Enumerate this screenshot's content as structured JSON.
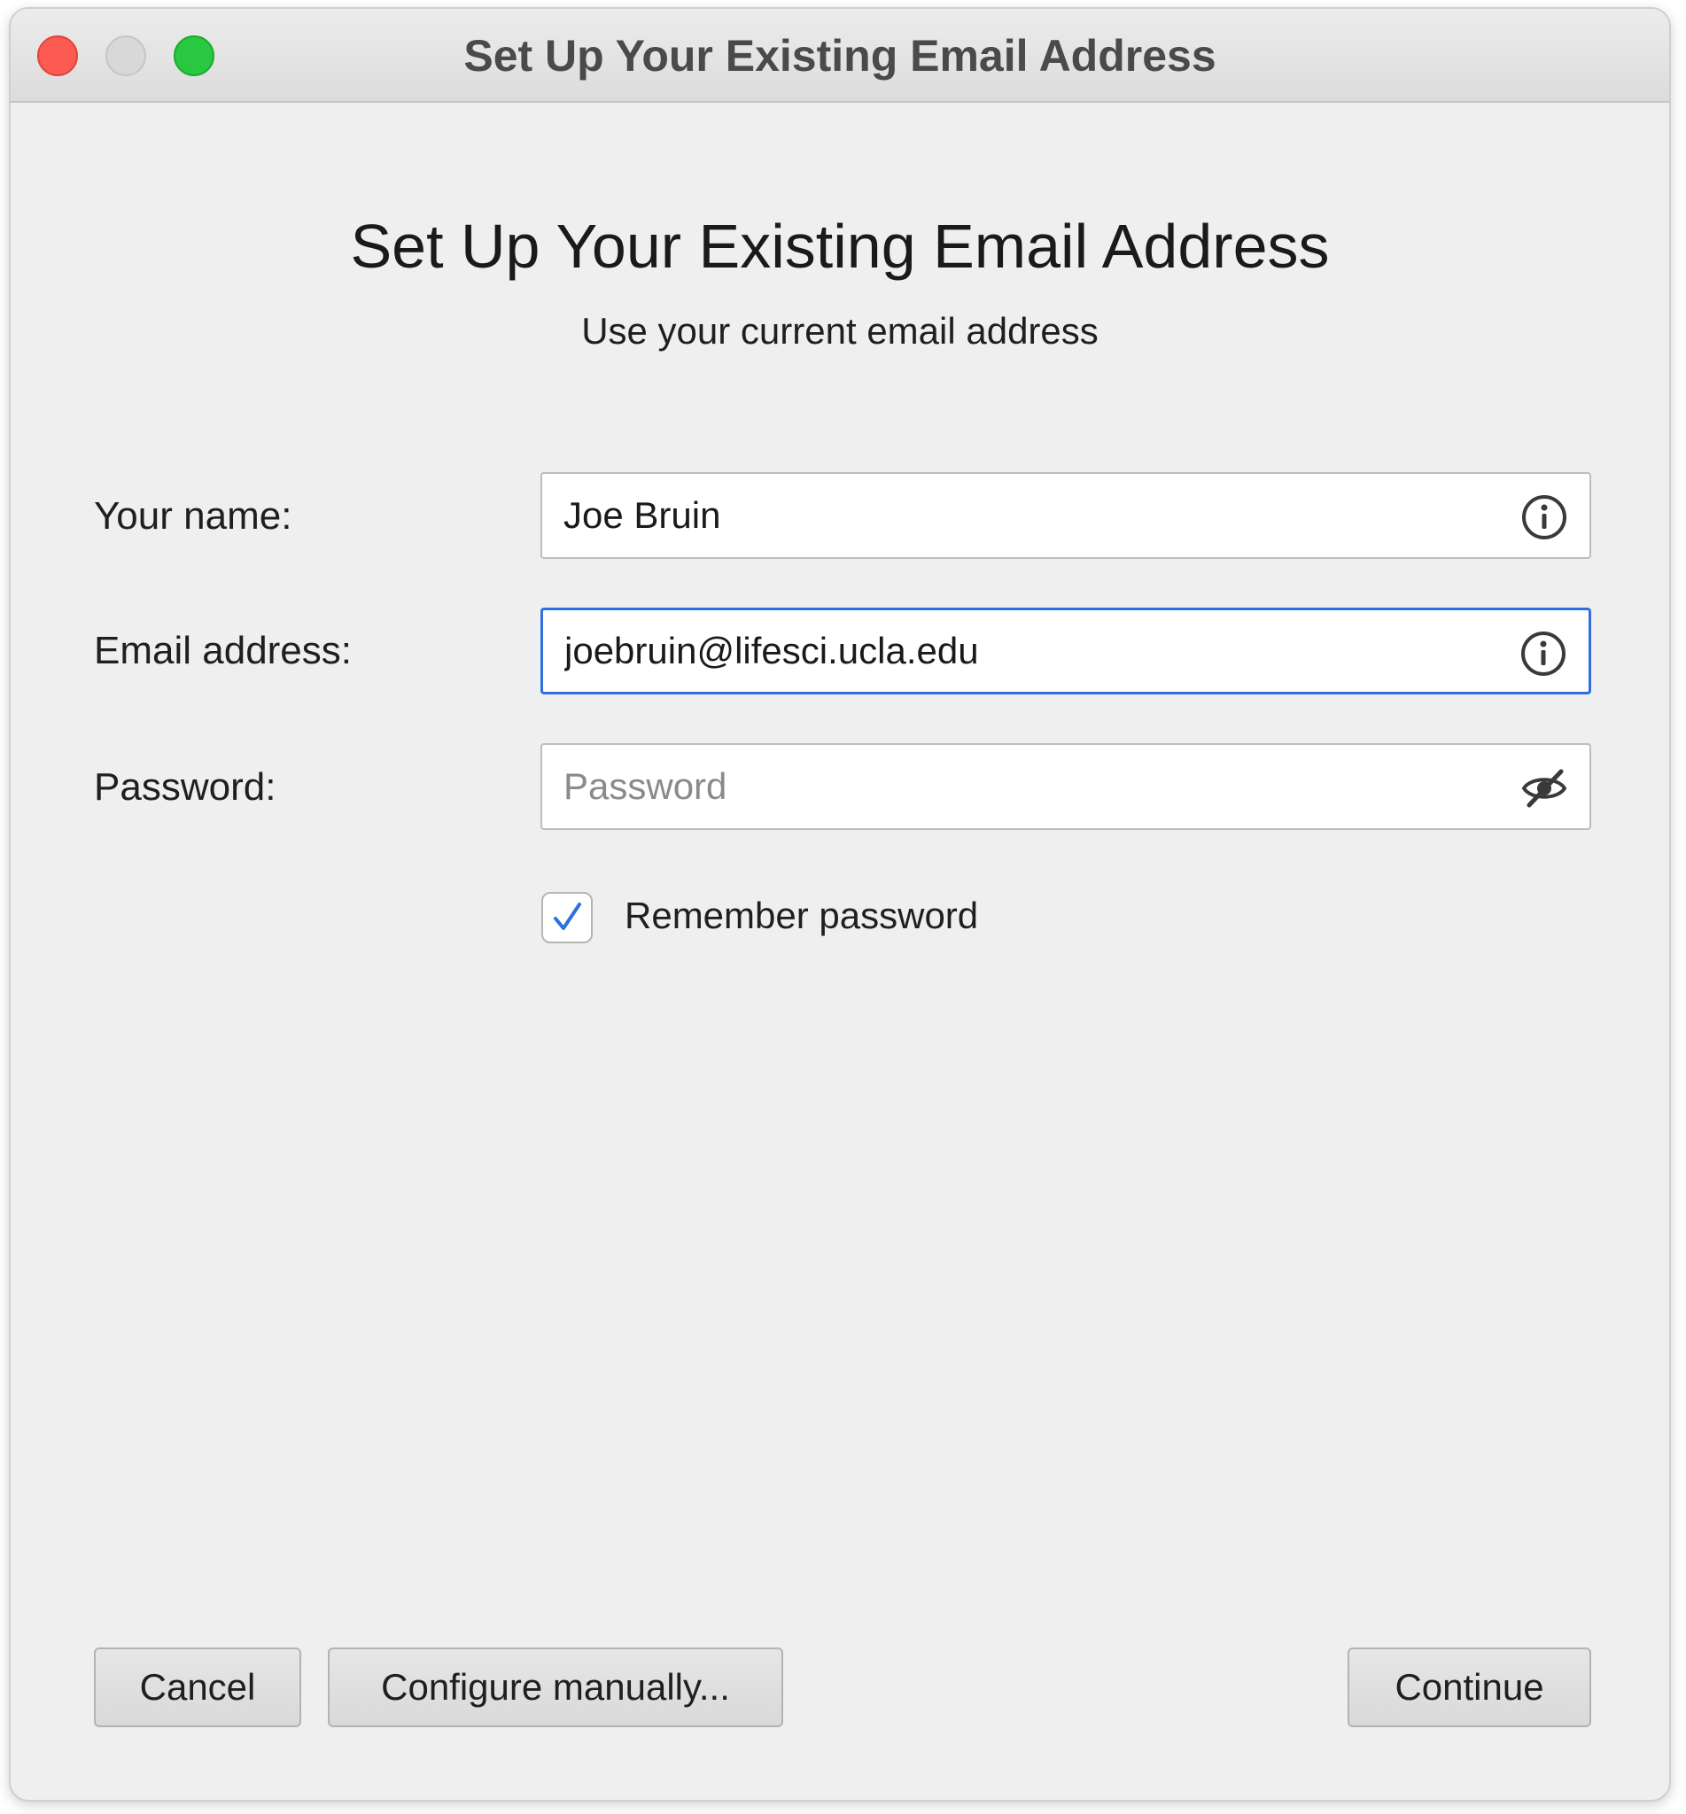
{
  "window": {
    "title": "Set Up Your Existing Email Address"
  },
  "header": {
    "title": "Set Up Your Existing Email Address",
    "subtitle": "Use your current email address"
  },
  "form": {
    "name": {
      "label": "Your name:",
      "value": "Joe Bruin",
      "icon": "info-icon"
    },
    "email": {
      "label": "Email address:",
      "value": "joebruin@lifesci.ucla.edu",
      "icon": "info-icon"
    },
    "password": {
      "label": "Password:",
      "value": "",
      "placeholder": "Password",
      "icon": "eye-slash-icon"
    },
    "remember": {
      "label": "Remember password",
      "checked": true
    }
  },
  "buttons": {
    "cancel": "Cancel",
    "configure": "Configure manually...",
    "continue": "Continue"
  },
  "colors": {
    "focus_accent": "#2f6fe0",
    "close": "#fd5b52",
    "zoom": "#28c840"
  }
}
